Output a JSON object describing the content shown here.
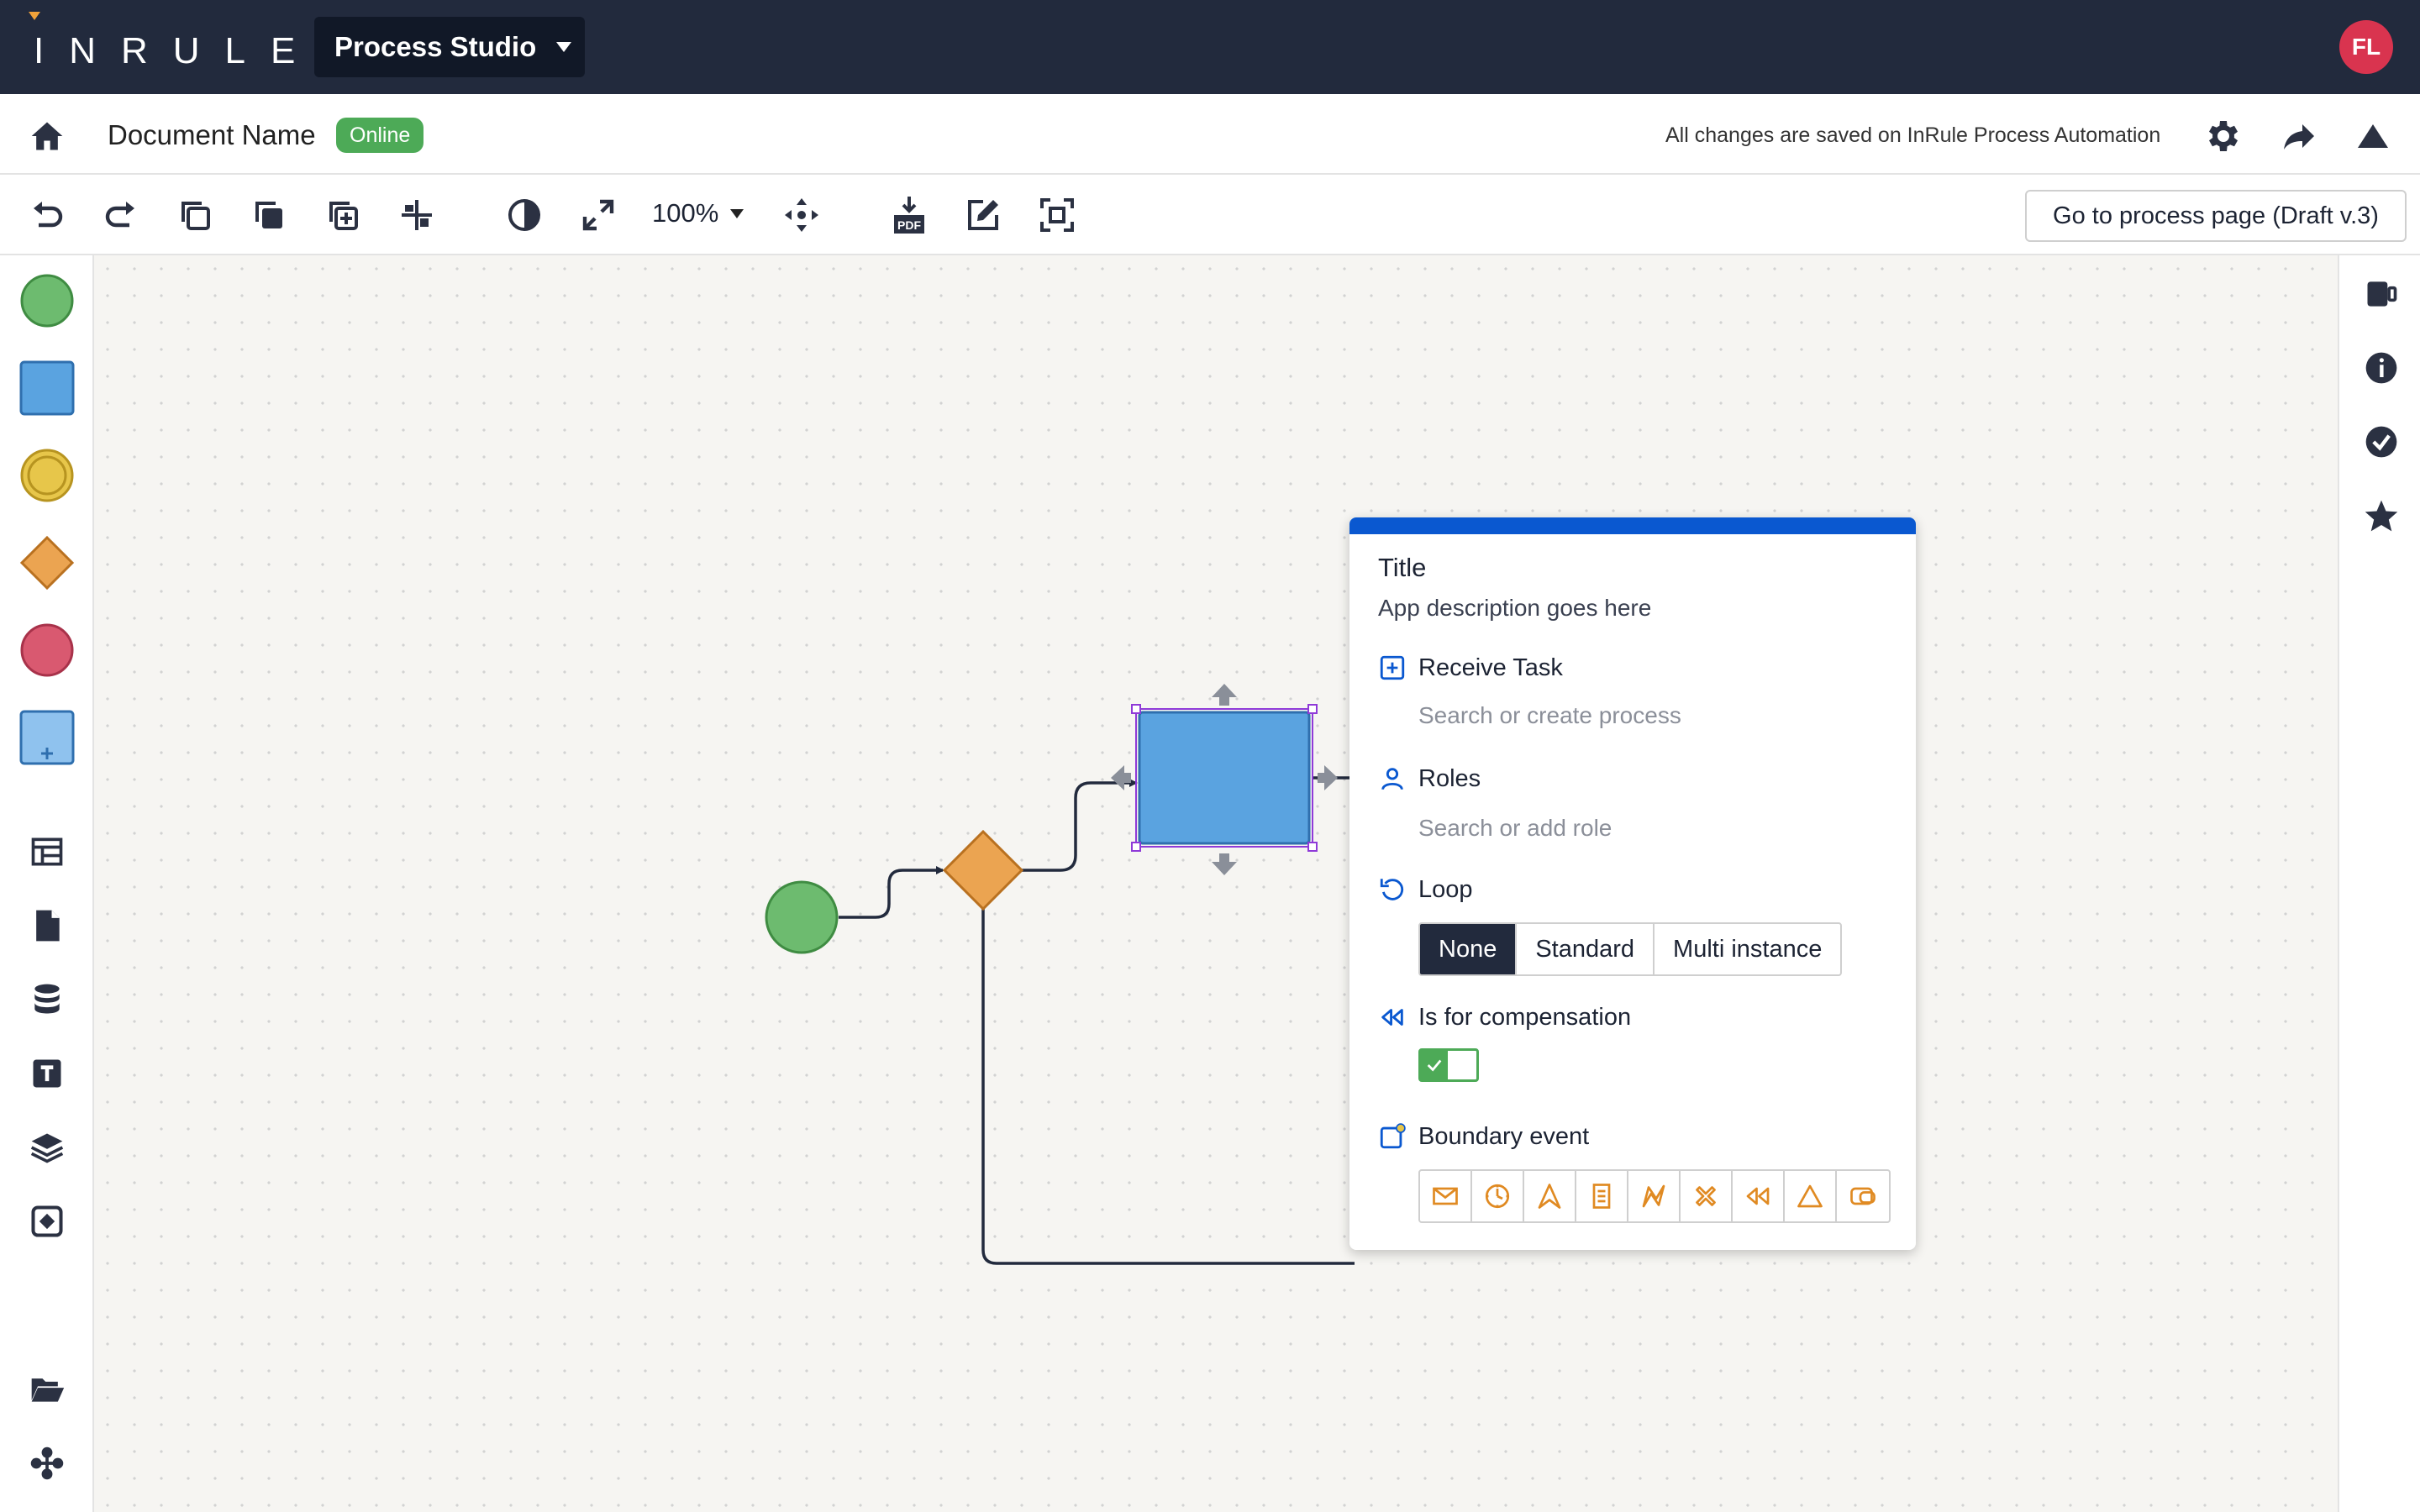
{
  "app": {
    "logo_text": "INRULE",
    "switcher_label": "Process Studio",
    "user_initials": "FL"
  },
  "document": {
    "name": "Document Name",
    "status_badge": "Online",
    "save_status": "All changes are saved on InRule Process Automation"
  },
  "toolbar": {
    "zoom_level": "100%",
    "process_page_button": "Go to process page (Draft v.3)",
    "icons": [
      "undo-icon",
      "redo-icon",
      "copy-icon",
      "duplicate-icon",
      "add-copy-icon",
      "align-icon",
      "contrast-icon",
      "expand-icon",
      "move-icon",
      "pdf-download-icon",
      "edit-icon",
      "fit-selection-icon"
    ]
  },
  "palette": {
    "shapes": [
      "start-event",
      "task",
      "intermediate-event",
      "gateway",
      "end-event",
      "subprocess"
    ],
    "tools": [
      "table-icon",
      "document-icon",
      "database-icon",
      "text-icon",
      "layers-icon",
      "component-icon",
      "folder-icon",
      "integration-icon"
    ]
  },
  "right_rail": {
    "icons": [
      "panel-icon",
      "info-icon",
      "check-icon",
      "star-icon"
    ]
  },
  "panel": {
    "title": "Title",
    "description": "App description goes here",
    "task_type_label": "Receive Task",
    "process_placeholder": "Search or create process",
    "roles_label": "Roles",
    "roles_placeholder": "Search or add role",
    "loop_label": "Loop",
    "loop_options": [
      "None",
      "Standard",
      "Multi instance"
    ],
    "loop_selected": "None",
    "compensation_label": "Is for compensation",
    "compensation_enabled": true,
    "boundary_label": "Boundary event",
    "boundary_events": [
      "message-icon",
      "timer-icon",
      "escalation-icon",
      "conditional-icon",
      "error-icon",
      "cancel-icon",
      "compensation-icon",
      "signal-icon",
      "multiple-icon"
    ]
  },
  "colors": {
    "topbar": "#222a3d",
    "accent_blue": "#0a58d0",
    "online_green": "#4daa57",
    "task_fill": "#5aa3e0",
    "gateway_fill": "#eba451",
    "start_fill": "#6dbb6f",
    "end_fill": "#d95970",
    "boundary_orange": "#e08a22"
  }
}
